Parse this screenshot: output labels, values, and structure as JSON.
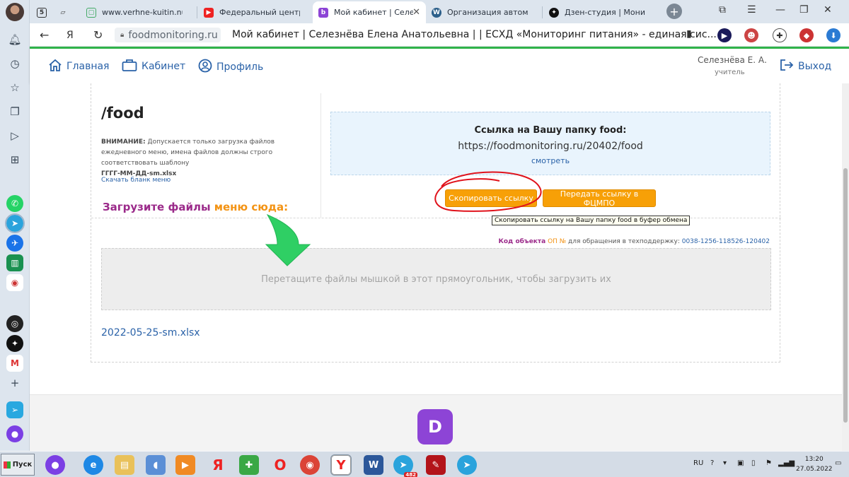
{
  "browser": {
    "tabs": [
      {
        "label": "www.verhne-kuitin.nuku",
        "active": false
      },
      {
        "label": "Федеральный центр мо",
        "active": false
      },
      {
        "label": "Мой кабинет | Селез",
        "active": true
      },
      {
        "label": "Организация автомати",
        "active": false
      },
      {
        "label": "Дзен-студия | Монитор",
        "active": false
      }
    ],
    "url": "foodmonitoring.ru",
    "page_title": "Мой кабинет | Селезнёва Елена Анатольевна | | ЕСХД «Мониторинг питания» - единая сис..."
  },
  "site": {
    "nav": {
      "home": "Главная",
      "cabinet": "Кабинет",
      "profile": "Профиль"
    },
    "user": {
      "name": "Селезнёва Е. А.",
      "role": "учитель"
    },
    "logout": "Выход"
  },
  "main": {
    "folder": "/food",
    "warning_label": "ВНИМАНИЕ:",
    "warning_text": "Допускается только загрузка файлов ежедневного меню, имена файлов должны строго соответствовать шаблону",
    "pattern": "ГГГГ-ММ-ДД-sm.xlsx",
    "download_blank": "Скачать бланк меню",
    "upload_title_a": "Загрузите файлы",
    "upload_title_b": "меню",
    "upload_title_c": "сюда:",
    "link_title": "Ссылка на Вашу папку food:",
    "link_url": "https://foodmonitoring.ru/20402/food",
    "link_view": "смотреть",
    "copy_button": "Скопировать ссылку",
    "send_button": "Передать ссылку в ФЦМПО",
    "tooltip": "Скопировать ссылку на Вашу папку food в буфер обмена",
    "object_code_label": "Код объекта",
    "object_code_op": "ОП №",
    "object_code_text": "для обращения в техподдержку:",
    "object_code_value": "0038-1256-118526-120402",
    "dropzone_text": "Перетащите файлы мышкой в этот прямоугольник, чтобы загрузить их",
    "file": "2022-05-25-sm.xlsx"
  },
  "taskbar": {
    "start": "Пуск",
    "badge_count": "482",
    "lang": "RU",
    "time": "13:20",
    "date": "27.05.2022"
  },
  "colors": {
    "accent_green": "#2fb34a",
    "link_blue": "#2a62a8",
    "button_orange": "#f7a007",
    "brand_purple": "#9b2a8a",
    "annotation_red": "#e0121b",
    "annotation_arrow": "#2fcf64"
  }
}
